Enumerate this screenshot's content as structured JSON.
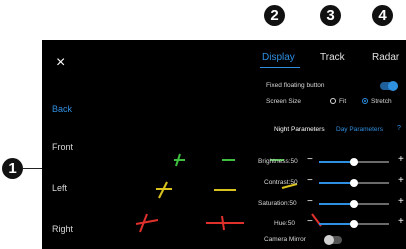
{
  "callouts": [
    "1",
    "2",
    "3",
    "4"
  ],
  "menu": {
    "close_icon": "×",
    "items": [
      "Back",
      "Front",
      "Left",
      "Right"
    ]
  },
  "tabs": [
    "Display",
    "Track",
    "Radar"
  ],
  "settings": {
    "fixed_floating_button": {
      "label": "Fixed floating button",
      "enabled": true
    },
    "screen_size": {
      "label": "Screen Size",
      "options": [
        "Fit",
        "Stretch"
      ],
      "selected": "Stretch"
    },
    "parameter_tabs": [
      "Night Parameters",
      "Day Parameters"
    ],
    "help": "?",
    "sliders": [
      {
        "label": "Brightness:50",
        "value": 50
      },
      {
        "label": "Contrast:50",
        "value": 50
      },
      {
        "label": "Saturation:50",
        "value": 50
      },
      {
        "label": "Hue:50",
        "value": 50
      }
    ],
    "minus": "−",
    "plus": "+",
    "camera_mirror": {
      "label": "Camera Mirror",
      "enabled": false
    }
  },
  "colors": {
    "accent": "#2f8fe0",
    "guide_green": "#3fbf3f",
    "guide_yellow": "#d9c21f",
    "guide_red": "#e0302b"
  }
}
